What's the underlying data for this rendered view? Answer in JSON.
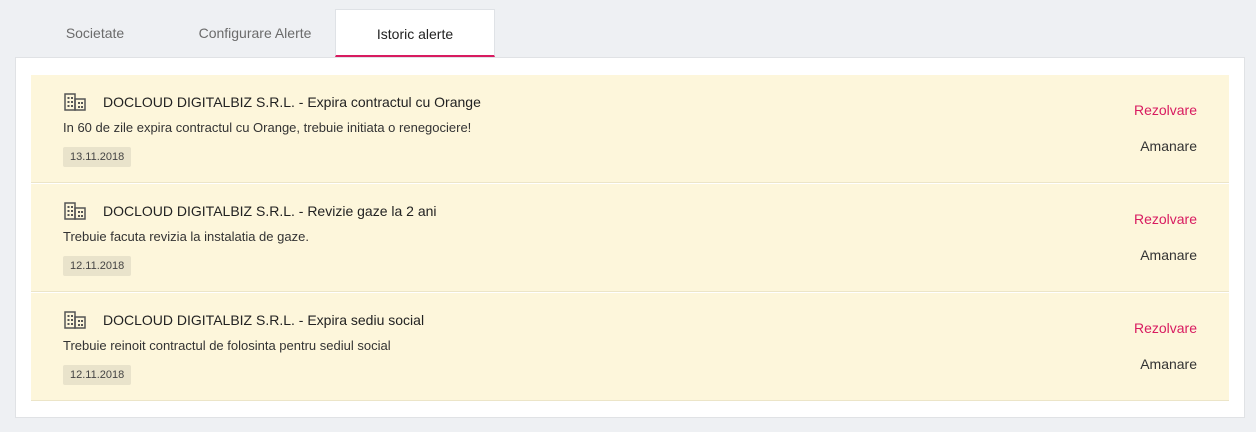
{
  "tabs": [
    {
      "label": "Societate"
    },
    {
      "label": "Configurare Alerte"
    },
    {
      "label": "Istoric alerte"
    }
  ],
  "alerts": [
    {
      "icon": "building-icon",
      "title": "DOCLOUD DIGITALBIZ S.R.L. - Expira contractul cu Orange",
      "description": "In 60 de zile expira contractul cu Orange, trebuie initiata o renegociere!",
      "date": "13.11.2018",
      "resolve_label": "Rezolvare",
      "postpone_label": "Amanare"
    },
    {
      "icon": "building-icon",
      "title": "DOCLOUD DIGITALBIZ S.R.L. - Revizie gaze la 2 ani",
      "description": "Trebuie facuta revizia la instalatia de gaze.",
      "date": "12.11.2018",
      "resolve_label": "Rezolvare",
      "postpone_label": "Amanare"
    },
    {
      "icon": "building-icon",
      "title": "DOCLOUD DIGITALBIZ S.R.L. - Expira sediu social",
      "description": "Trebuie reinoit contractul de folosinta pentru sediul social",
      "date": "12.11.2018",
      "resolve_label": "Rezolvare",
      "postpone_label": "Amanare"
    }
  ],
  "colors": {
    "accent": "#d81b60",
    "card_background": "#fdf6db",
    "page_background": "#eef0f3"
  }
}
